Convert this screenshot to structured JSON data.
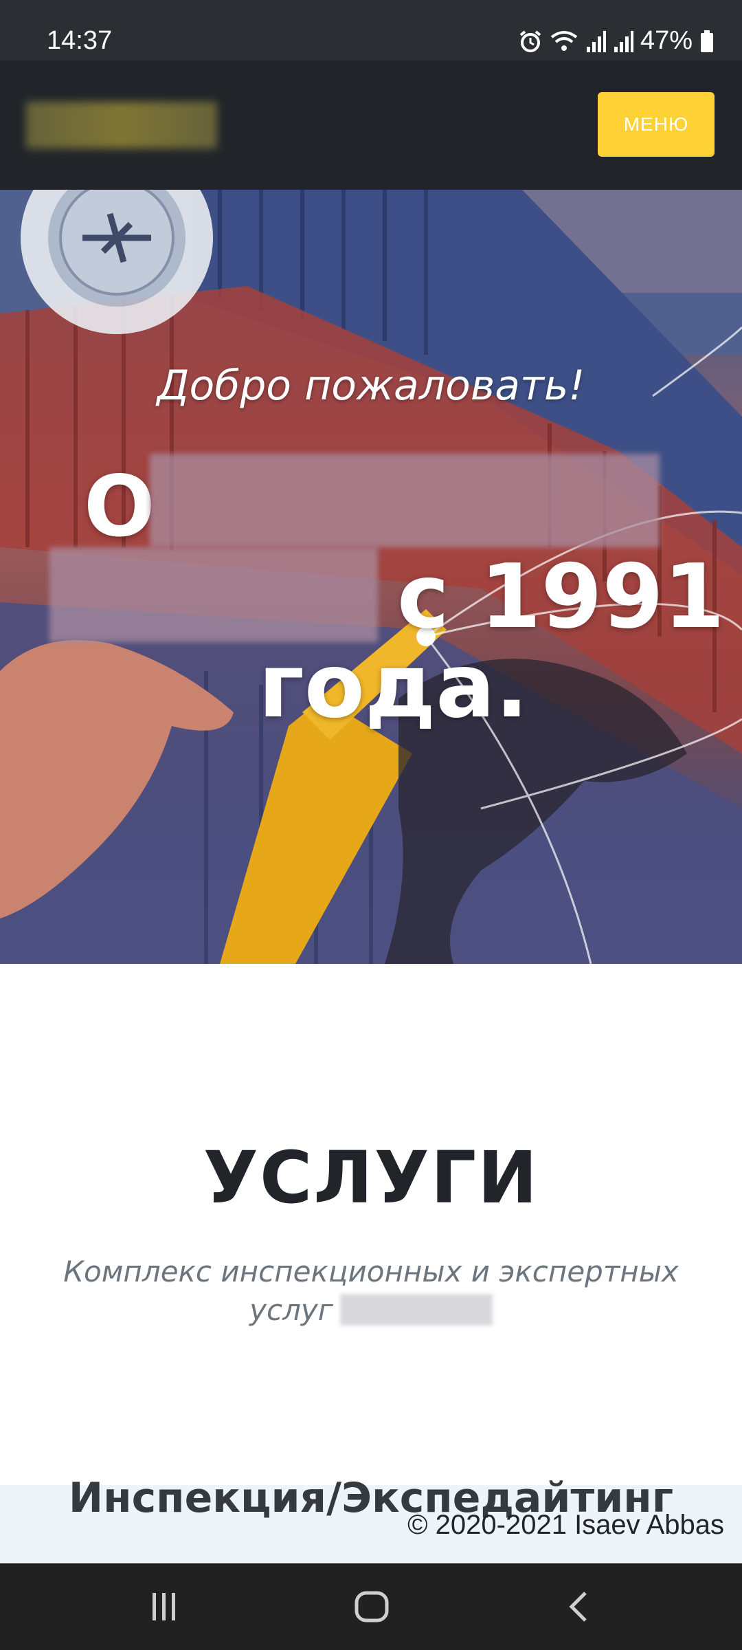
{
  "status_bar": {
    "time": "14:37",
    "battery": "47%",
    "icons": [
      "alarm-icon",
      "wifi-icon",
      "signal-icon",
      "signal-icon",
      "battery-icon"
    ]
  },
  "navbar": {
    "menu_label": "МЕНЮ"
  },
  "hero": {
    "subheading": "Добро пожаловать!",
    "title_line1": "О",
    "title_line2": "с 1991",
    "title_line3": "года."
  },
  "services": {
    "title": "УСЛУГИ",
    "subtitle_line1": "Комплекс инспекционных и экспертных",
    "subtitle_line2": "услуг",
    "first_service": "Инспекция/Экспедайтинг"
  },
  "footer": {
    "copyright": "© 2020-2021 Isaev Abbas"
  },
  "navigation_bar": {
    "icons": [
      "recent-apps-icon",
      "home-icon",
      "back-icon"
    ]
  },
  "colors": {
    "accent": "#fed136",
    "navbar": "#212529"
  }
}
